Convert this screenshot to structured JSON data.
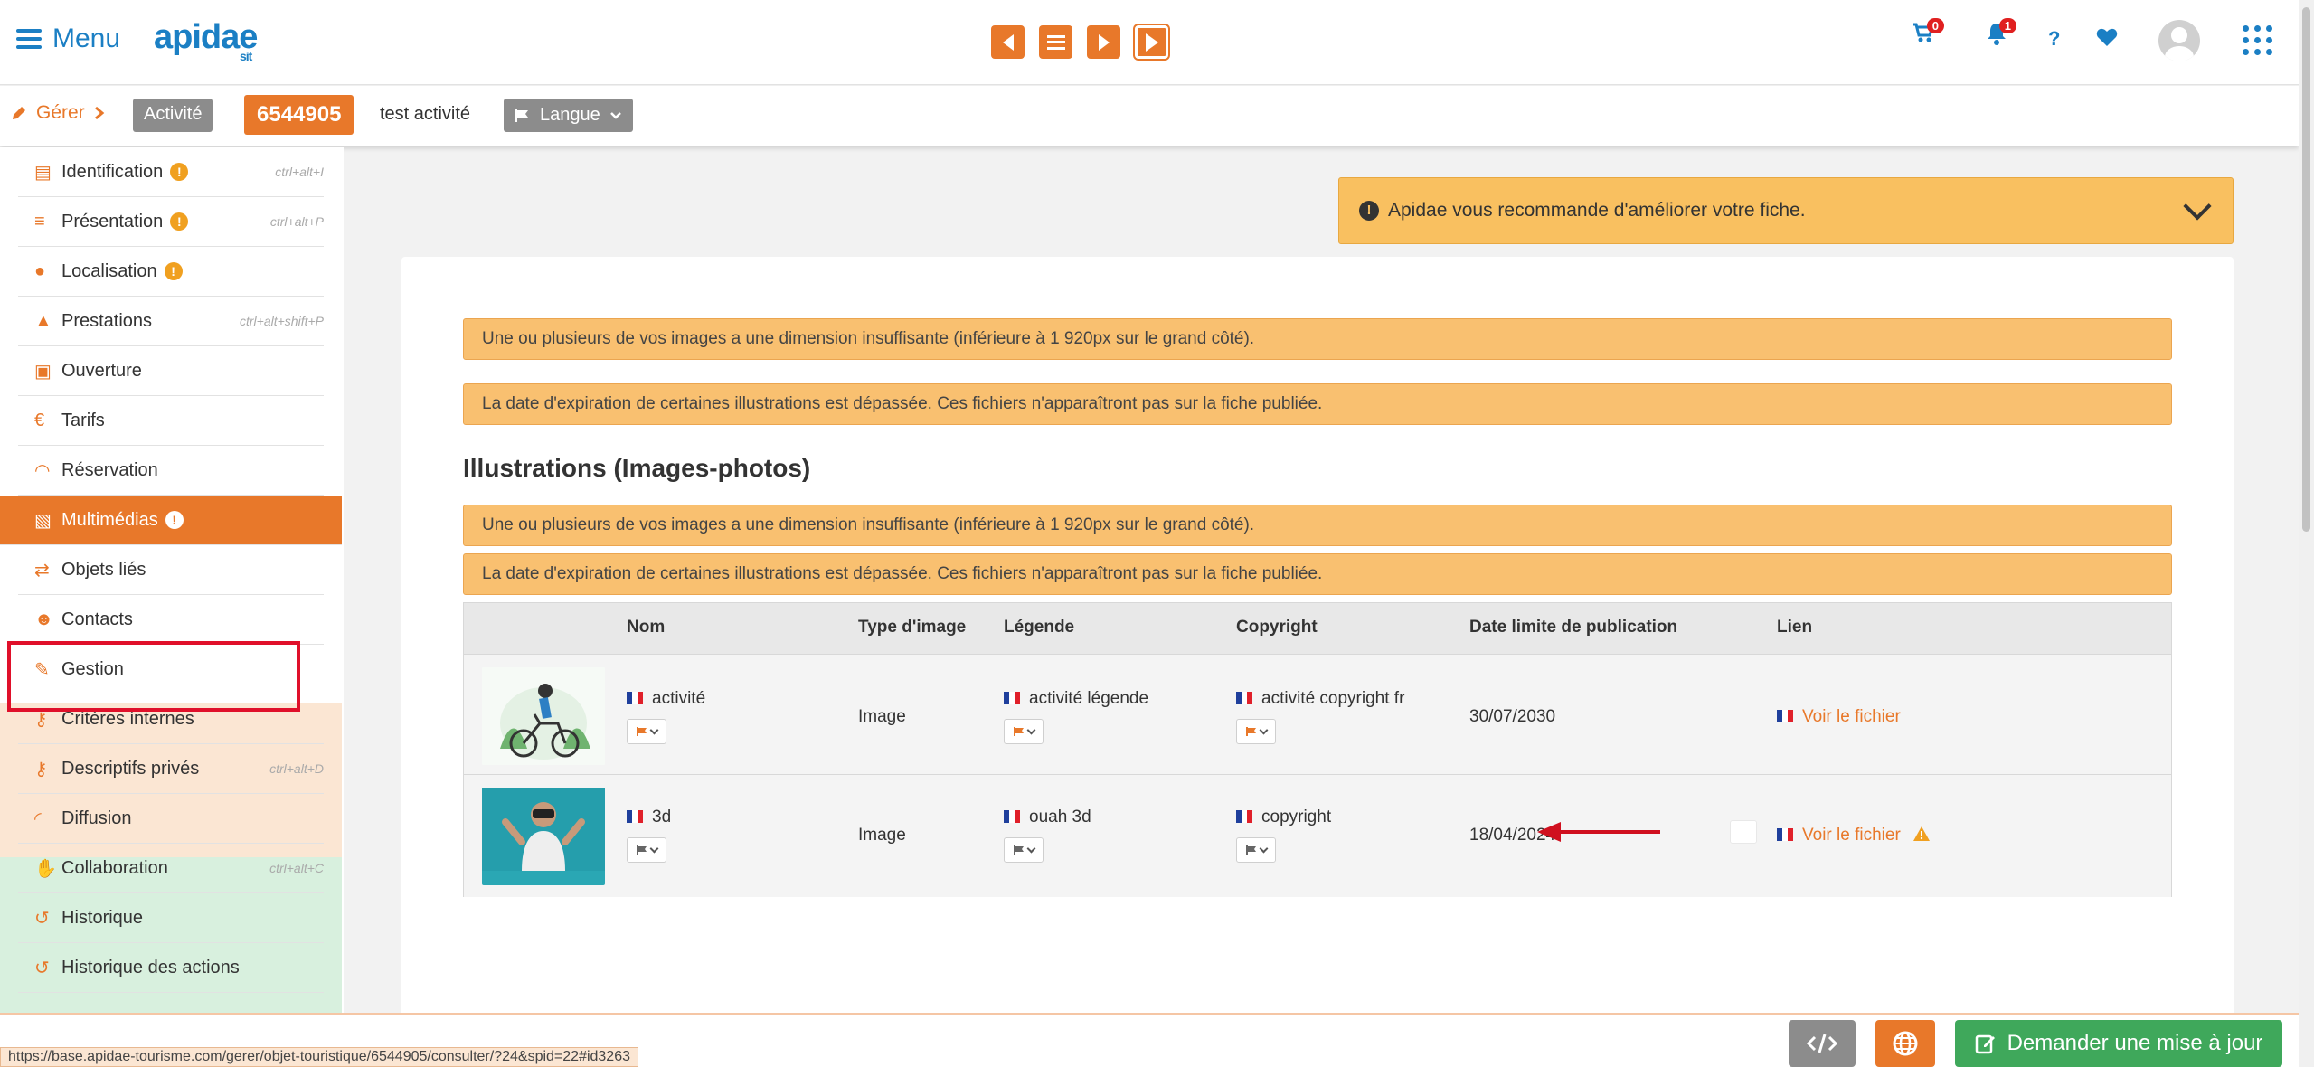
{
  "header": {
    "menu_label": "Menu",
    "logo_text": "apidae",
    "logo_sub": "sit",
    "cart_count": "0",
    "notif_count": "1",
    "help_label": "?"
  },
  "breadcrumb": {
    "gerer": "Gérer",
    "type": "Activité",
    "id": "6544905",
    "title": "test activité",
    "langue": "Langue"
  },
  "sidebar": {
    "items": [
      {
        "label": "Identification",
        "shortcut": "ctrl+alt+I",
        "warn": "!"
      },
      {
        "label": "Présentation",
        "shortcut": "ctrl+alt+P",
        "warn": "!"
      },
      {
        "label": "Localisation",
        "shortcut": "",
        "warn": "!"
      },
      {
        "label": "Prestations",
        "shortcut": "ctrl+alt+shift+P",
        "warn": ""
      },
      {
        "label": "Ouverture",
        "shortcut": "",
        "warn": ""
      },
      {
        "label": "Tarifs",
        "shortcut": "",
        "warn": ""
      },
      {
        "label": "Réservation",
        "shortcut": "",
        "warn": ""
      },
      {
        "label": "Multimédias",
        "shortcut": "",
        "warn": "!"
      },
      {
        "label": "Objets liés",
        "shortcut": "",
        "warn": ""
      },
      {
        "label": "Contacts",
        "shortcut": "",
        "warn": ""
      },
      {
        "label": "Gestion",
        "shortcut": "",
        "warn": ""
      },
      {
        "label": "Critères internes",
        "shortcut": "",
        "warn": ""
      },
      {
        "label": "Descriptifs privés",
        "shortcut": "ctrl+alt+D",
        "warn": ""
      },
      {
        "label": "Diffusion",
        "shortcut": "",
        "warn": ""
      },
      {
        "label": "Collaboration",
        "shortcut": "ctrl+alt+C",
        "warn": ""
      },
      {
        "label": "Historique",
        "shortcut": "",
        "warn": ""
      },
      {
        "label": "Historique des actions",
        "shortcut": "",
        "warn": ""
      }
    ]
  },
  "main": {
    "recommendation": "Apidae vous recommande d'améliorer votre fiche.",
    "alerts_top": [
      "Une ou plusieurs de vos images a une dimension insuffisante (inférieure à 1 920px sur le grand côté).",
      "La date d'expiration de certaines illustrations est dépassée. Ces fichiers n'apparaîtront pas sur la fiche publiée."
    ],
    "section_title": "Illustrations (Images-photos)",
    "alerts_section": [
      "Une ou plusieurs de vos images a une dimension insuffisante (inférieure à 1 920px sur le grand côté).",
      "La date d'expiration de certaines illustrations est dépassée. Ces fichiers n'apparaîtront pas sur la fiche publiée."
    ],
    "table": {
      "headers": [
        "Nom",
        "Type d'image",
        "Légende",
        "Copyright",
        "Date limite de publication",
        "Lien"
      ],
      "rows": [
        {
          "nom": "activité",
          "type": "Image",
          "legende": "activité légende",
          "copyright": "activité copyright fr",
          "date": "30/07/2030",
          "lien": "Voir le fichier"
        },
        {
          "nom": "3d",
          "type": "Image",
          "legende": "ouah 3d",
          "copyright": "copyright",
          "date": "18/04/2024",
          "lien": "Voir le fichier"
        }
      ]
    }
  },
  "footer": {
    "status_url": "https://base.apidae-tourisme.com/gerer/objet-touristique/6544905/consulter/?24&spid=22#id3263",
    "update_button": "Demander une mise à jour"
  },
  "colors": {
    "accent": "#e8782a",
    "brand_blue": "#1b7fc4",
    "alert_bg": "#f9c070",
    "highlight_red": "#e0102a"
  }
}
